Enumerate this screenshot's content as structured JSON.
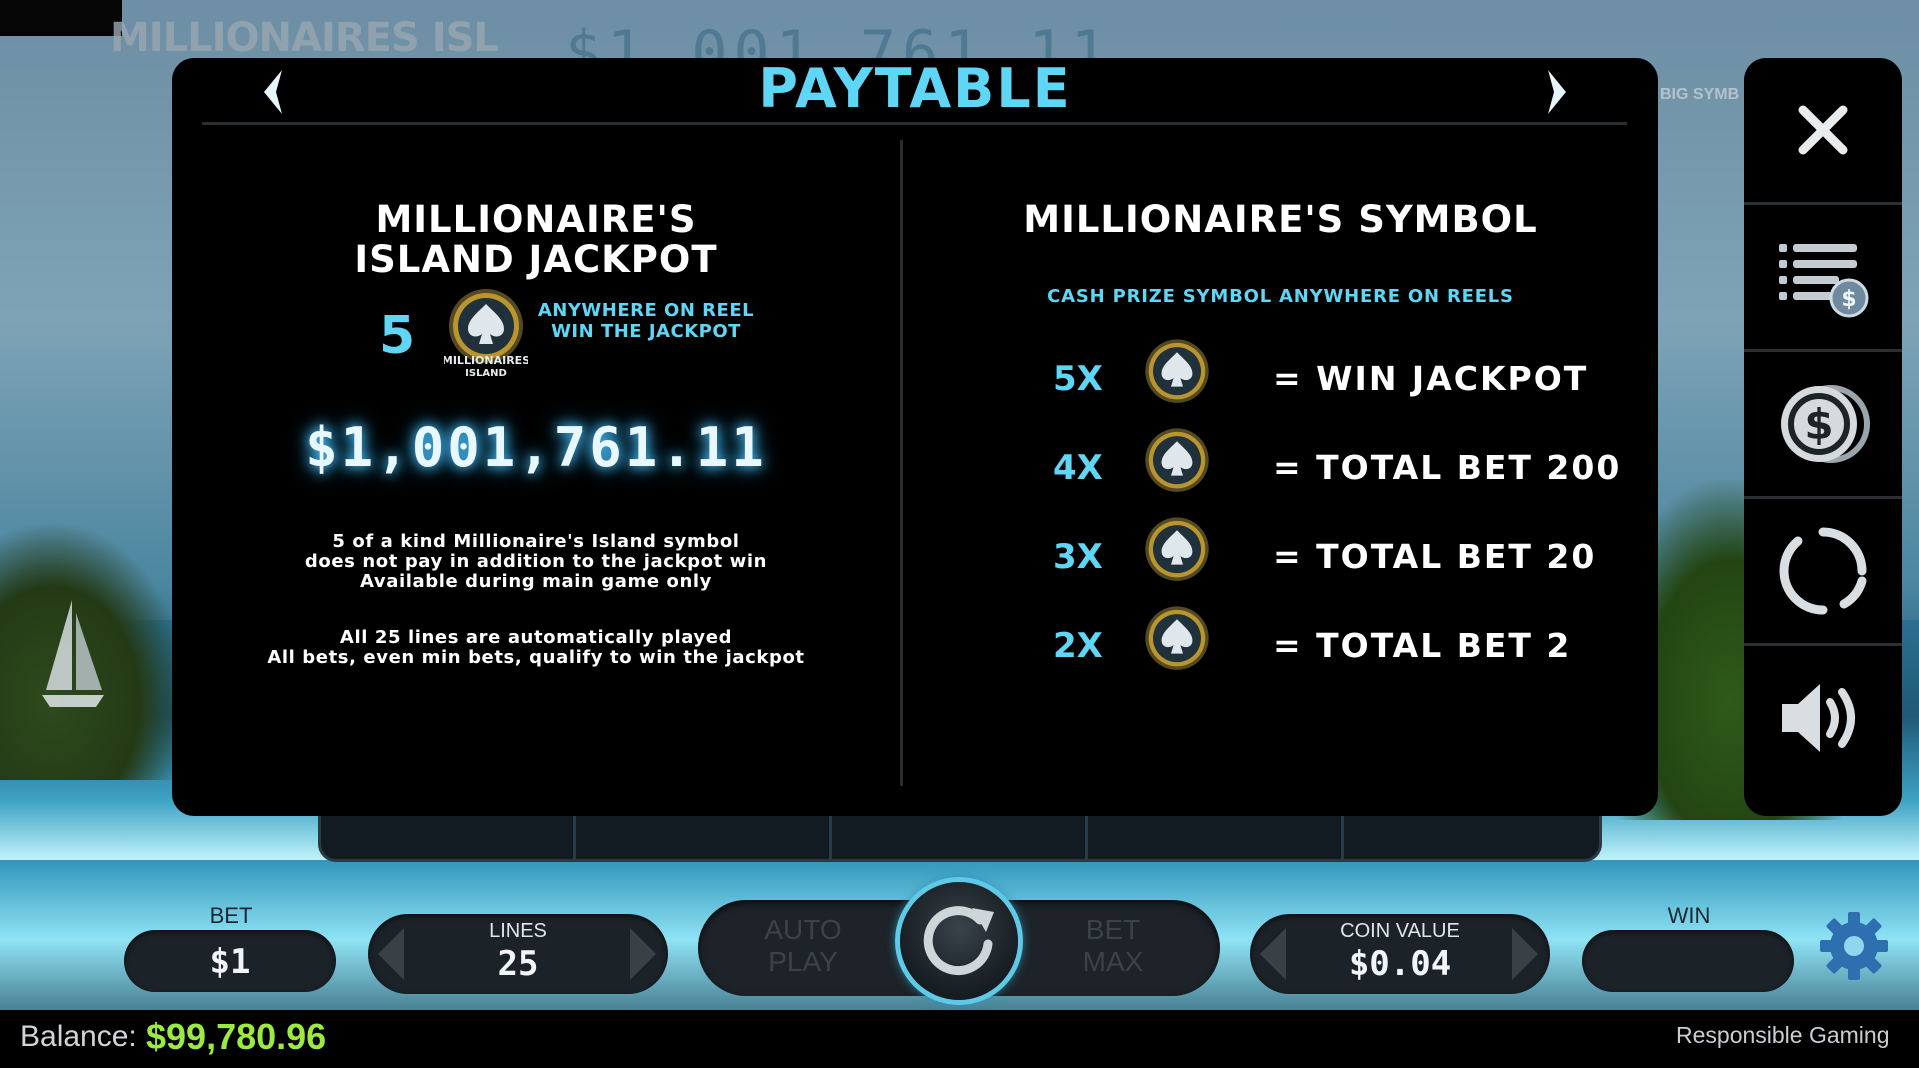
{
  "background": {
    "logo_text": "MILLIONAIRES ISL",
    "big_symbols_label": "BIG SYMB",
    "jackpot_ghost": "$1,001,761.11"
  },
  "paytable": {
    "title": "PAYTABLE",
    "left": {
      "heading": "MILLIONAIRE'S ISLAND JACKPOT",
      "count": "5",
      "note": "ANYWHERE ON REEL WIN THE JACKPOT",
      "jackpot_amount": "$1,001,761.11",
      "info_1": [
        "5 of a kind Millionaire's Island symbol",
        "does not pay in addition to the jackpot win",
        "Available during main game only"
      ],
      "info_2": [
        "All 25 lines are automatically played",
        "All bets, even min bets, qualify to win the jackpot"
      ]
    },
    "right": {
      "heading": "MILLIONAIRE'S SYMBOL",
      "subheading": "CASH PRIZE SYMBOL ANYWHERE ON REELS",
      "rows": [
        {
          "multiplier": "5X",
          "prize": "= WIN JACKPOT"
        },
        {
          "multiplier": "4X",
          "prize": "= TOTAL BET 200"
        },
        {
          "multiplier": "3X",
          "prize": "= TOTAL BET 20"
        },
        {
          "multiplier": "2X",
          "prize": "= TOTAL BET 2"
        }
      ]
    },
    "coin_text": [
      "MILLIONAIRES",
      "ISLAND"
    ]
  },
  "sidebar": {
    "icons": [
      "close-icon",
      "paytable-icon",
      "cash-icon",
      "history-icon",
      "sound-icon"
    ]
  },
  "controls": {
    "bet_label": "BET",
    "bet_value": "$1",
    "lines_label": "LINES",
    "lines_value": "25",
    "autoplay_label": [
      "AUTO",
      "PLAY"
    ],
    "betmax_label": [
      "BET",
      "MAX"
    ],
    "coin_value_label": "COIN VALUE",
    "coin_value": "$0.04",
    "win_label": "WIN",
    "win_value": ""
  },
  "status": {
    "balance_label": "Balance:",
    "balance_value": "$99,780.96",
    "responsible_gaming": "Responsible Gaming"
  },
  "colors": {
    "accent_cyan": "#5fd6f5",
    "balance_green": "#9bea3f",
    "panel_bg": "#000000"
  }
}
